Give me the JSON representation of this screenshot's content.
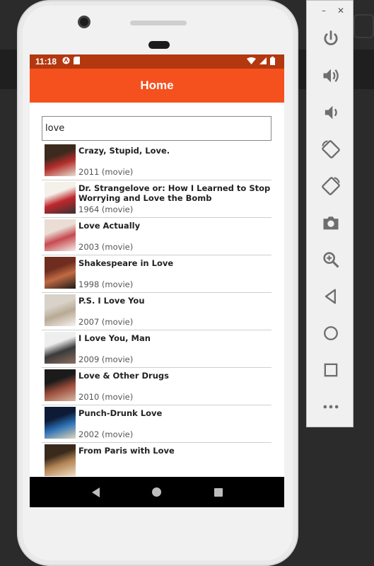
{
  "status_bar": {
    "time": "11:18"
  },
  "app_bar": {
    "title": "Home"
  },
  "search": {
    "value": "love"
  },
  "movies": [
    {
      "title": "Crazy, Stupid, Love.",
      "year_type": "2011 (movie)",
      "poster_colors": [
        "#3b2a1d",
        "#b32d2a",
        "#e8e0d0"
      ]
    },
    {
      "title": "Dr. Strangelove or: How I Learned to Stop Worrying and Love the Bomb",
      "year_type": "1964 (movie)",
      "poster_colors": [
        "#f4f1ea",
        "#c0262c",
        "#333333"
      ]
    },
    {
      "title": "Love Actually",
      "year_type": "2003 (movie)",
      "poster_colors": [
        "#e9ddd4",
        "#c74a50",
        "#f3eee8"
      ]
    },
    {
      "title": "Shakespeare in Love",
      "year_type": "1998 (movie)",
      "poster_colors": [
        "#6f2d1f",
        "#c06a44",
        "#1d1a18"
      ]
    },
    {
      "title": "P.S. I Love You",
      "year_type": "2007 (movie)",
      "poster_colors": [
        "#d8d2c9",
        "#b9a995",
        "#f6f4f0"
      ]
    },
    {
      "title": "I Love You, Man",
      "year_type": "2009 (movie)",
      "poster_colors": [
        "#eeeeee",
        "#3a3a3a",
        "#8d6e5f"
      ]
    },
    {
      "title": "Love & Other Drugs",
      "year_type": "2010 (movie)",
      "poster_colors": [
        "#1c1b1b",
        "#9a4d3a",
        "#d9b9a5"
      ]
    },
    {
      "title": "Punch-Drunk Love",
      "year_type": "2002 (movie)",
      "poster_colors": [
        "#0d1b36",
        "#2b6fb4",
        "#e0d8b8"
      ]
    },
    {
      "title": "From Paris with Love",
      "year_type": "",
      "poster_colors": [
        "#3a2a1c",
        "#b38454",
        "#efe0c6"
      ]
    }
  ],
  "toolbar": {
    "buttons": [
      "power-icon",
      "volume-up-icon",
      "volume-down-icon",
      "rotate-left-icon",
      "rotate-right-icon",
      "camera-icon",
      "zoom-icon",
      "back-icon",
      "home-icon",
      "overview-icon",
      "more-icon"
    ],
    "minimize": "–",
    "close": "✕"
  }
}
